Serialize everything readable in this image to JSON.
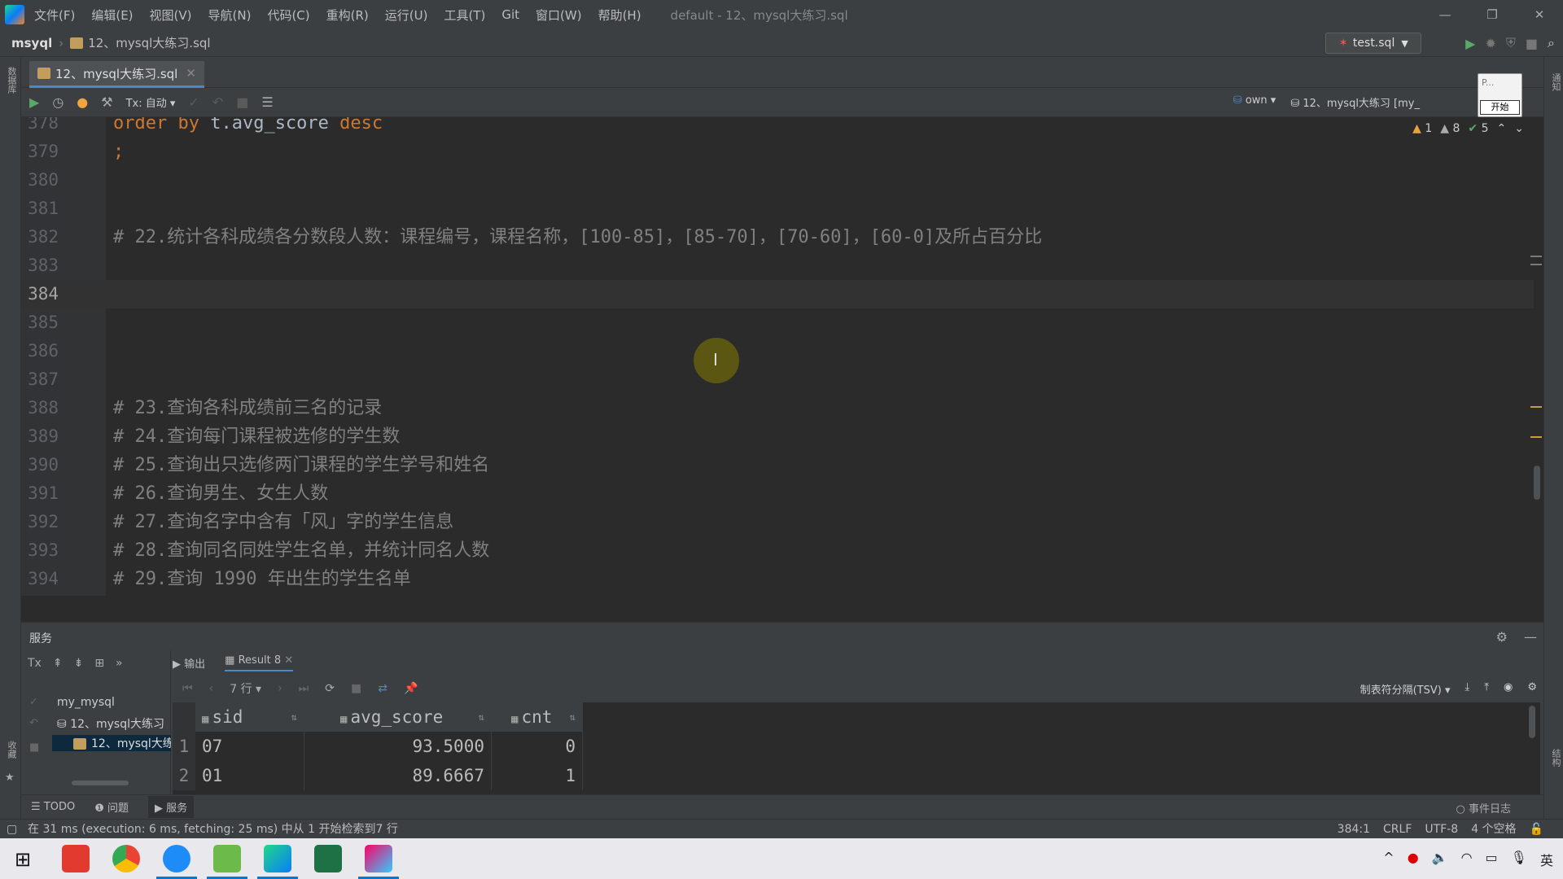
{
  "window": {
    "menu": [
      "文件(F)",
      "编辑(E)",
      "视图(V)",
      "导航(N)",
      "代码(C)",
      "重构(R)",
      "运行(U)",
      "工具(T)",
      "Git",
      "窗口(W)",
      "帮助(H)"
    ],
    "title": "default - 12、mysql大练习.sql",
    "controls": [
      "—",
      "❐",
      "✕"
    ]
  },
  "nav": {
    "project": "msyql",
    "file": "12、mysql大练习.sql"
  },
  "run_config": {
    "label": "test.sql"
  },
  "side": {
    "left_top": "数据库",
    "left_bottom": "收藏",
    "right_top": "通知",
    "right_bottom": "结构"
  },
  "editor_tab": {
    "label": "12、mysql大练习.sql",
    "close": "✕"
  },
  "sql_toolbar": {
    "tx_mode": "Tx: 自动",
    "session": "own",
    "datasource": "12、mysql大练习 [my_"
  },
  "popup": {
    "text": "P...",
    "button": "开始"
  },
  "inspection": {
    "warn1": "1",
    "warn2": "8",
    "ok": "5"
  },
  "editor_lines": [
    {
      "num": "378",
      "kind": "sql",
      "text": ""
    },
    {
      "num": "379",
      "kind": "sql",
      "text": ""
    },
    {
      "num": "380",
      "kind": "blank",
      "text": ""
    },
    {
      "num": "381",
      "kind": "blank",
      "text": ""
    },
    {
      "num": "382",
      "kind": "comment",
      "text": "# 22.统计各科成绩各分数段人数：课程编号，课程名称，[100-85]，[85-70]，[70-60]，[60-0]及所占百分比"
    },
    {
      "num": "383",
      "kind": "blank",
      "text": ""
    },
    {
      "num": "384",
      "kind": "current",
      "text": ""
    },
    {
      "num": "385",
      "kind": "blank",
      "text": ""
    },
    {
      "num": "386",
      "kind": "blank",
      "text": ""
    },
    {
      "num": "387",
      "kind": "blank",
      "text": ""
    },
    {
      "num": "388",
      "kind": "comment",
      "text": "# 23.查询各科成绩前三名的记录"
    },
    {
      "num": "389",
      "kind": "comment",
      "text": "# 24.查询每门课程被选修的学生数"
    },
    {
      "num": "390",
      "kind": "comment",
      "text": "# 25.查询出只选修两门课程的学生学号和姓名"
    },
    {
      "num": "391",
      "kind": "comment",
      "text": "# 26.查询男生、女生人数"
    },
    {
      "num": "392",
      "kind": "comment",
      "text": "# 27.查询名字中含有「风」字的学生信息"
    },
    {
      "num": "393",
      "kind": "comment",
      "text": "# 28.查询同名同姓学生名单，并统计同名人数"
    },
    {
      "num": "394",
      "kind": "comment",
      "text": "# 29.查询 1990 年出生的学生名单"
    }
  ],
  "line378": {
    "kw1": "order by",
    "ident": "t.avg_score",
    "kw2": "desc"
  },
  "line379": {
    "text": ";"
  },
  "services": {
    "title": "服务",
    "tree": {
      "conn": "my_mysql",
      "console": "12、mysql大练习",
      "file": "12、mysql大练"
    },
    "tabs": {
      "output": "输出",
      "result": "Result 8"
    },
    "rows_label": "7 行",
    "export_format": "制表符分隔(TSV)"
  },
  "grid": {
    "columns": [
      "sid",
      "avg_score",
      "cnt"
    ],
    "rows": [
      {
        "n": "1",
        "sid": "07",
        "avg_score": "93.5000",
        "cnt": "0"
      },
      {
        "n": "2",
        "sid": "01",
        "avg_score": "89.6667",
        "cnt": "1"
      }
    ]
  },
  "bottom_tabs": {
    "todo": "TODO",
    "problems": "问题",
    "services": "服务",
    "eventlog": "事件日志"
  },
  "status": {
    "message": "在 31 ms (execution: 6 ms, fetching: 25 ms) 中从 1 开始检索到7 行",
    "position": "384:1",
    "line_sep": "CRLF",
    "encoding": "UTF-8",
    "indent": "4 个空格"
  },
  "tray": {
    "ime": "英"
  },
  "colors": {
    "bg": "#2b2b2b",
    "panel": "#3c3f41",
    "keyword": "#cc7832",
    "comment": "#808080",
    "accent": "#4a88c7"
  }
}
